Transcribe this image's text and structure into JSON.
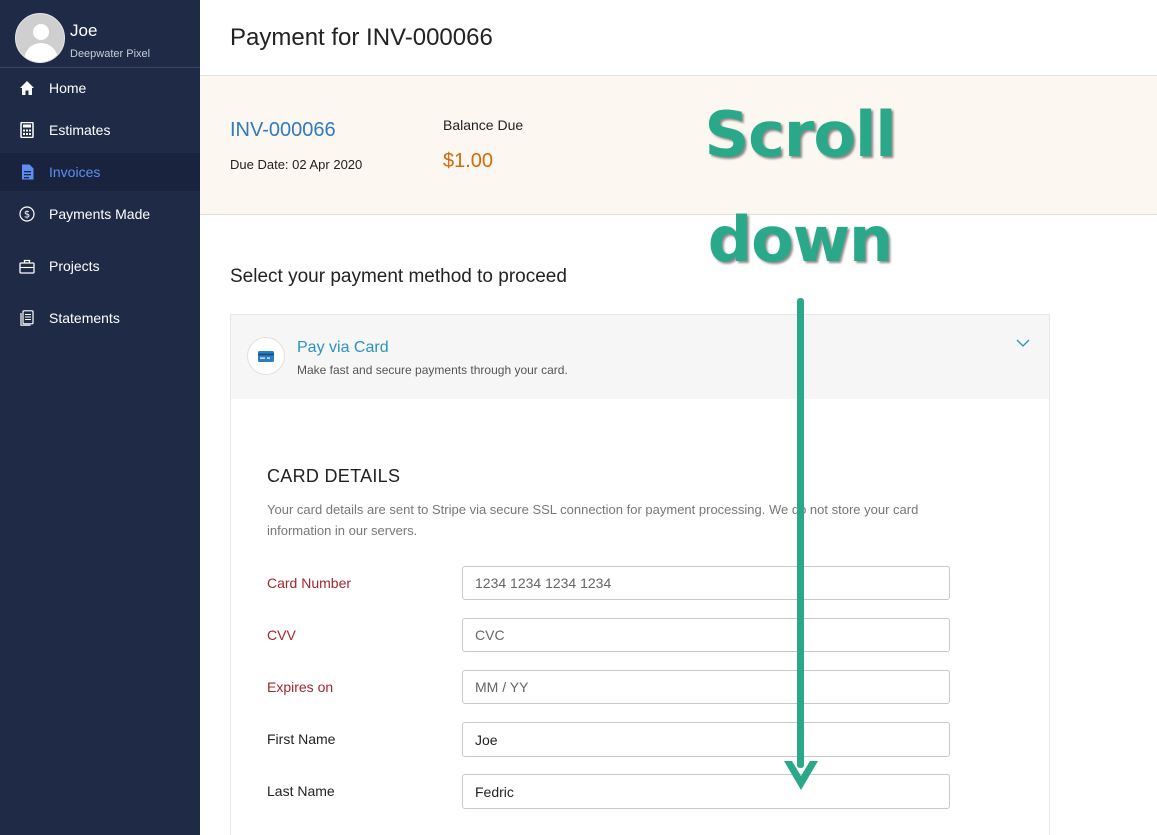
{
  "user": {
    "name": "Joe",
    "organization": "Deepwater Pixel"
  },
  "sidebar": {
    "items": [
      {
        "label": "Home",
        "icon": "home-icon",
        "active": false
      },
      {
        "label": "Estimates",
        "icon": "calculator-icon",
        "active": false
      },
      {
        "label": "Invoices",
        "icon": "document-icon",
        "active": true
      },
      {
        "label": "Payments Made",
        "icon": "dollar-circle-icon",
        "active": false
      },
      {
        "label": "Projects",
        "icon": "briefcase-icon",
        "active": false
      },
      {
        "label": "Statements",
        "icon": "statement-icon",
        "active": false
      }
    ]
  },
  "header": {
    "title": "Payment for INV-000066"
  },
  "invoice": {
    "number": "INV-000066",
    "due_date": "Due Date: 02 Apr 2020",
    "balance_label": "Balance Due",
    "balance_value": "$1.00"
  },
  "payment": {
    "section_title": "Select your payment method to proceed",
    "method_title": "Pay via Card",
    "method_subtitle": "Make fast and secure payments through your card."
  },
  "card_details": {
    "title": "CARD DETAILS",
    "note": "Your card details are sent to Stripe via secure SSL connection for payment processing. We do not store your card information in our servers.",
    "fields": {
      "card_number": {
        "label": "Card Number",
        "value": "",
        "placeholder": "1234 1234 1234 1234"
      },
      "cvv": {
        "label": "CVV",
        "value": "",
        "placeholder": "CVC"
      },
      "expires": {
        "label": "Expires on",
        "value": "",
        "placeholder": "MM / YY"
      },
      "first_name": {
        "label": "First Name",
        "value": "Joe",
        "placeholder": ""
      },
      "last_name": {
        "label": "Last Name",
        "value": "Fedric",
        "placeholder": ""
      }
    }
  },
  "annotation": {
    "line1": "Scroll",
    "line2": "down",
    "color": "#2aa88a"
  },
  "colors": {
    "sidebar_bg": "#1f2a47",
    "active_nav": "#5e8ef3",
    "link_blue": "#2f7bbf",
    "balance_orange": "#d36a0c",
    "required_red": "#a3262d"
  }
}
